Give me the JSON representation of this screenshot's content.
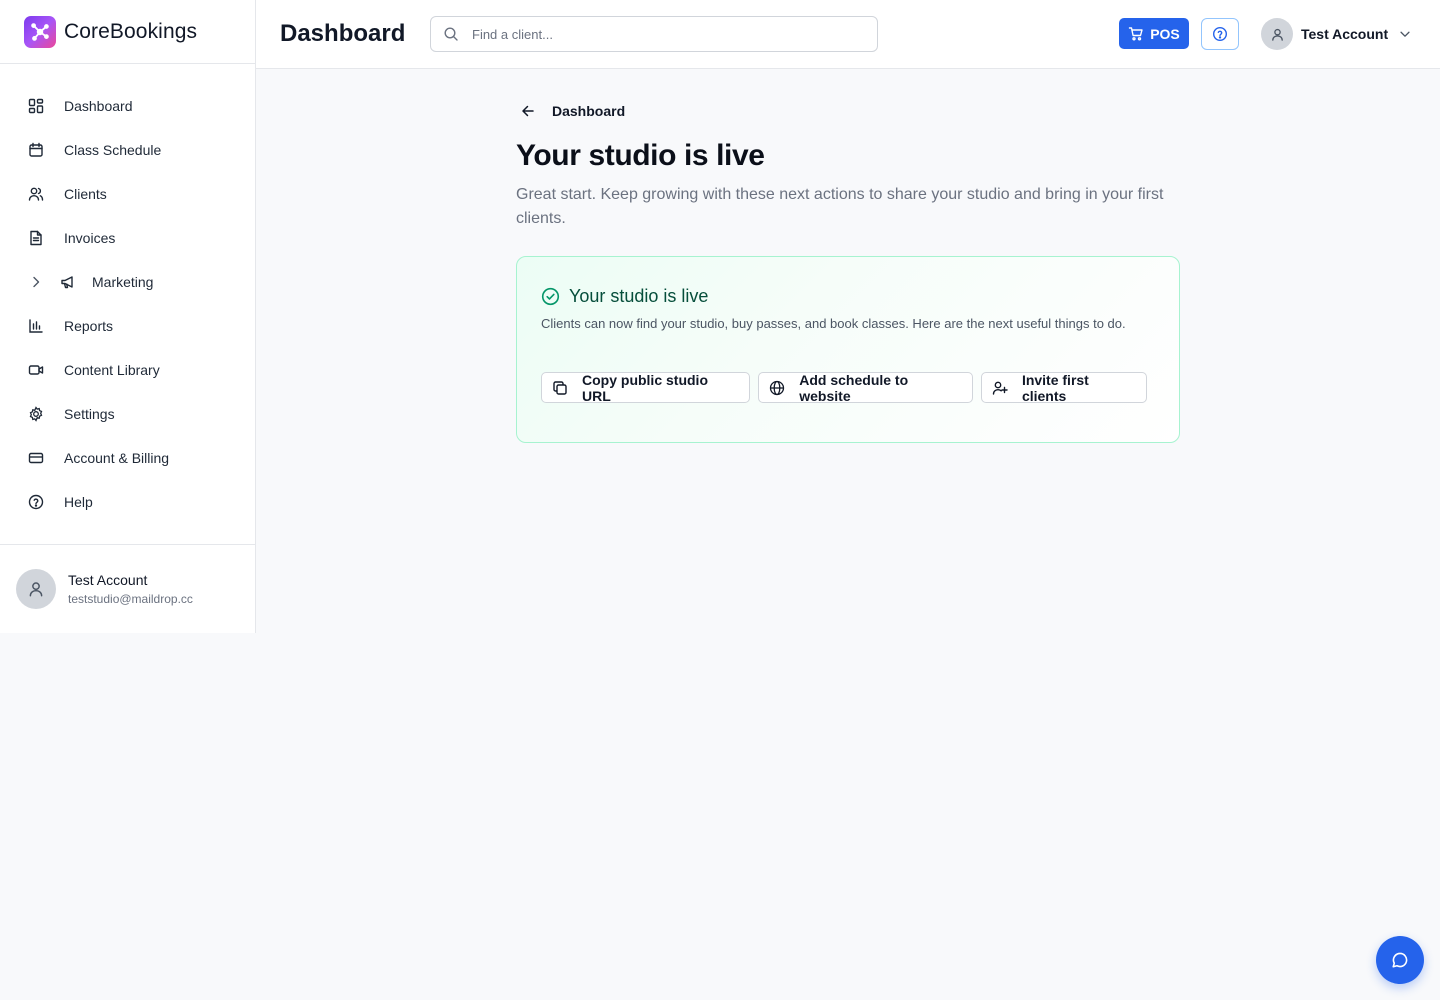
{
  "brand": {
    "name": "CoreBookings"
  },
  "sidebar": {
    "items": [
      {
        "label": "Dashboard",
        "icon": "dashboard-grid-icon"
      },
      {
        "label": "Class Schedule",
        "icon": "calendar-icon"
      },
      {
        "label": "Clients",
        "icon": "users-icon"
      },
      {
        "label": "Invoices",
        "icon": "document-icon"
      },
      {
        "label": "Marketing",
        "icon": "megaphone-icon",
        "collapsed": true
      },
      {
        "label": "Reports",
        "icon": "bar-chart-icon"
      },
      {
        "label": "Content Library",
        "icon": "video-icon"
      },
      {
        "label": "Settings",
        "icon": "gear-icon"
      },
      {
        "label": "Account & Billing",
        "icon": "credit-card-icon"
      },
      {
        "label": "Help",
        "icon": "help-circle-icon"
      }
    ],
    "user": {
      "name": "Test Account",
      "email": "teststudio@maildrop.cc"
    }
  },
  "header": {
    "title": "Dashboard",
    "search_placeholder": "Find a client...",
    "pos_label": "POS",
    "account_name": "Test Account"
  },
  "main": {
    "back_label": "Dashboard",
    "heading": "Your studio is live",
    "lead": "Great start. Keep growing with these next actions to share your studio and bring in your first clients.",
    "card": {
      "title": "Your studio is live",
      "text": "Clients can now find your studio, buy passes, and book classes. Here are the next useful things to do.",
      "actions": [
        {
          "label": "Copy public studio URL",
          "icon": "copy-icon"
        },
        {
          "label": "Add schedule to website",
          "icon": "globe-icon"
        },
        {
          "label": "Invite first clients",
          "icon": "user-plus-icon"
        }
      ]
    }
  },
  "colors": {
    "accent": "#2563eb",
    "success": "#059669",
    "card_border": "#a7f3d0",
    "background": "#f8f9fb"
  }
}
